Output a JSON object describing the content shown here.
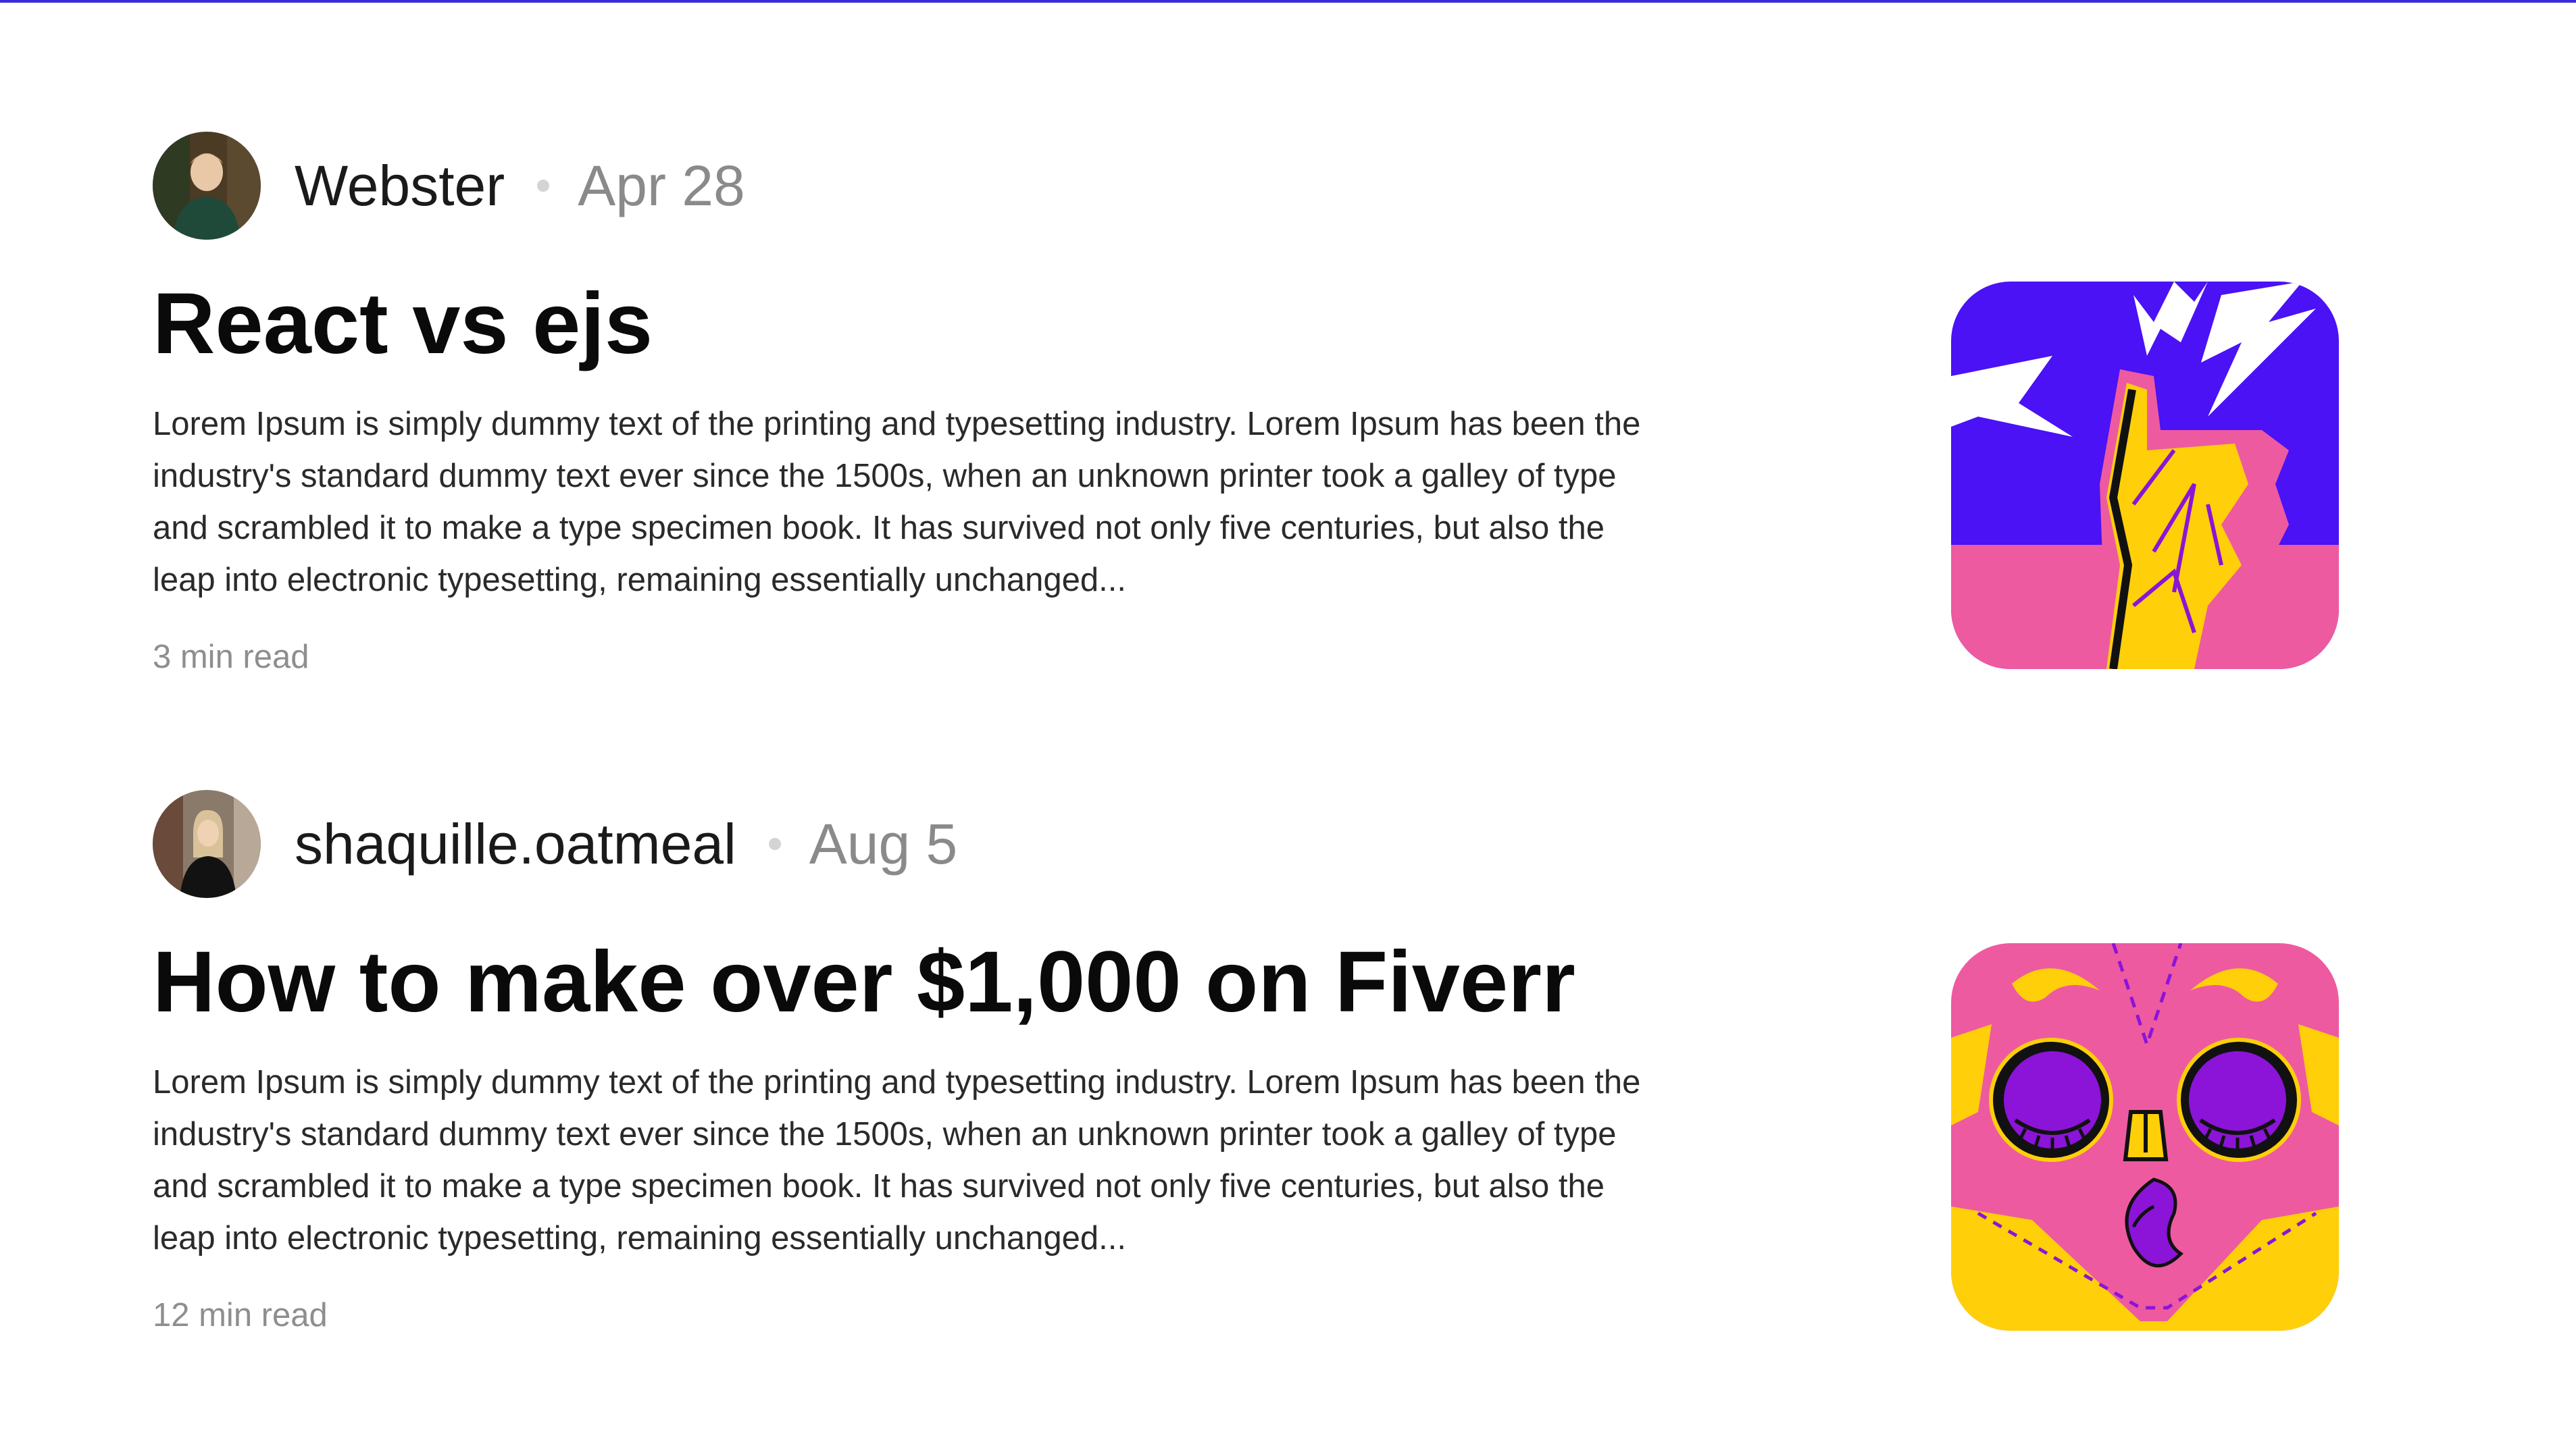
{
  "articles": [
    {
      "author": "Webster",
      "date": "Apr 28",
      "title": "React vs ejs",
      "excerpt": "Lorem Ipsum is simply dummy text of the printing and typesetting industry. Lorem Ipsum has been the industry's standard dummy text ever since the 1500s, when an unknown printer took a galley of type and scrambled it to make a type specimen book. It has survived not only five centuries, but also the leap into electronic typesetting, remaining essentially unchanged...",
      "read_time": "3 min read",
      "thumbnail_icon": "thumbs-up-illustration"
    },
    {
      "author": "shaquille.oatmeal",
      "date": "Aug 5",
      "title": "How to make over $1,000 on Fiverr",
      "excerpt": "Lorem Ipsum is simply dummy text of the printing and typesetting industry. Lorem Ipsum has been the industry's standard dummy text ever since the 1500s, when an unknown printer took a galley of type and scrambled it to make a type specimen book. It has survived not only five centuries, but also the leap into electronic typesetting, remaining essentially unchanged...",
      "read_time": "12 min read",
      "thumbnail_icon": "owl-face-illustration"
    }
  ],
  "colors": {
    "accent_line": "#3a2bd6",
    "purple": "#4a12f5",
    "pink": "#ee5aa0",
    "yellow": "#ffcf0a",
    "violet": "#8b14d8"
  }
}
